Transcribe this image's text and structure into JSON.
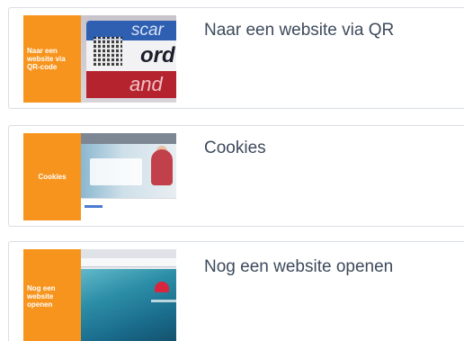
{
  "items": [
    {
      "thumb_label": "Naar een\nwebsite via\nQR-code",
      "photo_text": {
        "line1": "scar",
        "line2": "ord",
        "line3": "and"
      },
      "title": "Naar een website via QR"
    },
    {
      "thumb_label": "Cookies",
      "title": "Cookies"
    },
    {
      "thumb_label": "Nog een\nwebsite\nopenen",
      "title": "Nog een website openen"
    }
  ],
  "colors": {
    "accent": "#f7941d",
    "title_text": "#3d4a5c",
    "card_border": "#d9dde3"
  }
}
